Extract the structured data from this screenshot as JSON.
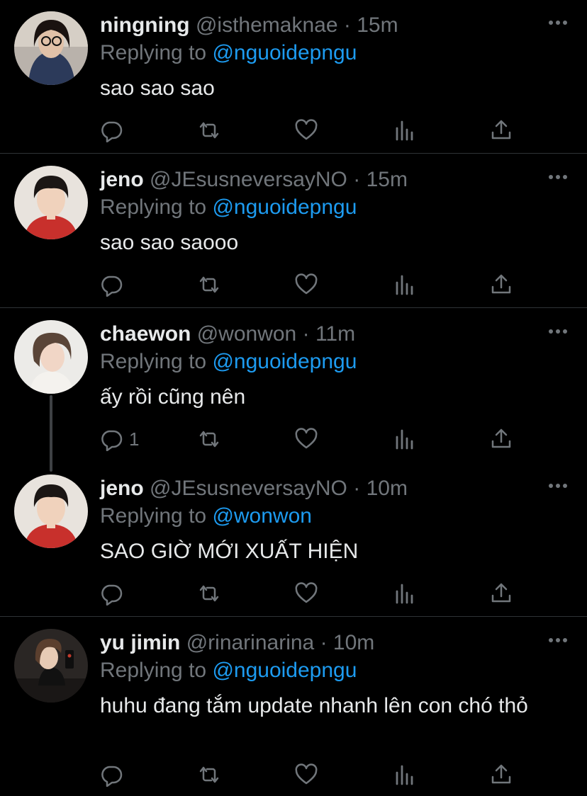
{
  "colors": {
    "background": "#000000",
    "text": "#e7e9ea",
    "muted": "#71767b",
    "accent": "#1d9bf0",
    "divider": "#2f3336"
  },
  "replying_prefix": "Replying to",
  "tweets": [
    {
      "name": "ningning",
      "handle": "@isthemaknae",
      "time": "15m",
      "reply_to": "@nguoidepngu",
      "text": "sao sao sao",
      "reply_count": "",
      "avatar": "woman-with-glasses-avatar"
    },
    {
      "name": "jeno",
      "handle": "@JEsusneversayNO",
      "time": "15m",
      "reply_to": "@nguoidepngu",
      "text": "sao sao saooo",
      "reply_count": "",
      "avatar": "boy-red-shirt-avatar"
    },
    {
      "name": "chaewon",
      "handle": "@wonwon",
      "time": "11m",
      "reply_to": "@nguoidepngu",
      "text": "ấy rồi cũng nên",
      "reply_count": "1",
      "avatar": "girl-light-background-avatar"
    },
    {
      "name": "jeno",
      "handle": "@JEsusneversayNO",
      "time": "10m",
      "reply_to": "@wonwon",
      "text": "SAO GIỜ MỚI XUẤT HIỆN",
      "reply_count": "",
      "avatar": "boy-red-shirt-avatar"
    },
    {
      "name": "yu jimin",
      "handle": "@rinarinarina",
      "time": "10m",
      "reply_to": "@nguoidepngu",
      "text": "huhu đang tắm update nhanh lên con chó thỏ",
      "reply_count": "",
      "avatar": "woman-dark-background-avatar"
    }
  ]
}
